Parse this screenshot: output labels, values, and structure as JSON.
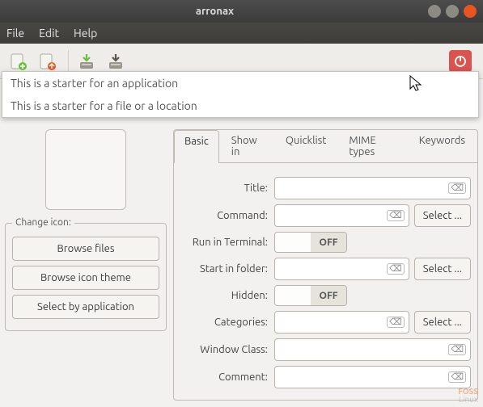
{
  "window": {
    "title": "arronax"
  },
  "menu": {
    "file": "File",
    "edit": "Edit",
    "help": "Help"
  },
  "dropdown": {
    "item1": "This is a starter for an application",
    "item2": "This is a starter for a file or a location"
  },
  "iconbox": {
    "legend": "Change icon:",
    "browse_files": "Browse files",
    "browse_theme": "Browse icon theme",
    "select_app": "Select by application"
  },
  "tabs": {
    "basic": "Basic",
    "showin": "Show in",
    "quicklist": "Quicklist",
    "mime": "MIME types",
    "keywords": "Keywords"
  },
  "form": {
    "title_label": "Title:",
    "command_label": "Command:",
    "terminal_label": "Run in Terminal:",
    "startfolder_label": "Start in folder:",
    "hidden_label": "Hidden:",
    "categories_label": "Categories:",
    "windowclass_label": "Window Class:",
    "comment_label": "Comment:",
    "select_btn": "Select ...",
    "toggle_off": "OFF",
    "values": {
      "title": "",
      "command": "",
      "startfolder": "",
      "categories": "",
      "windowclass": "",
      "comment": ""
    }
  },
  "watermark": {
    "line1": "FOSS",
    "line2": "Linux"
  }
}
